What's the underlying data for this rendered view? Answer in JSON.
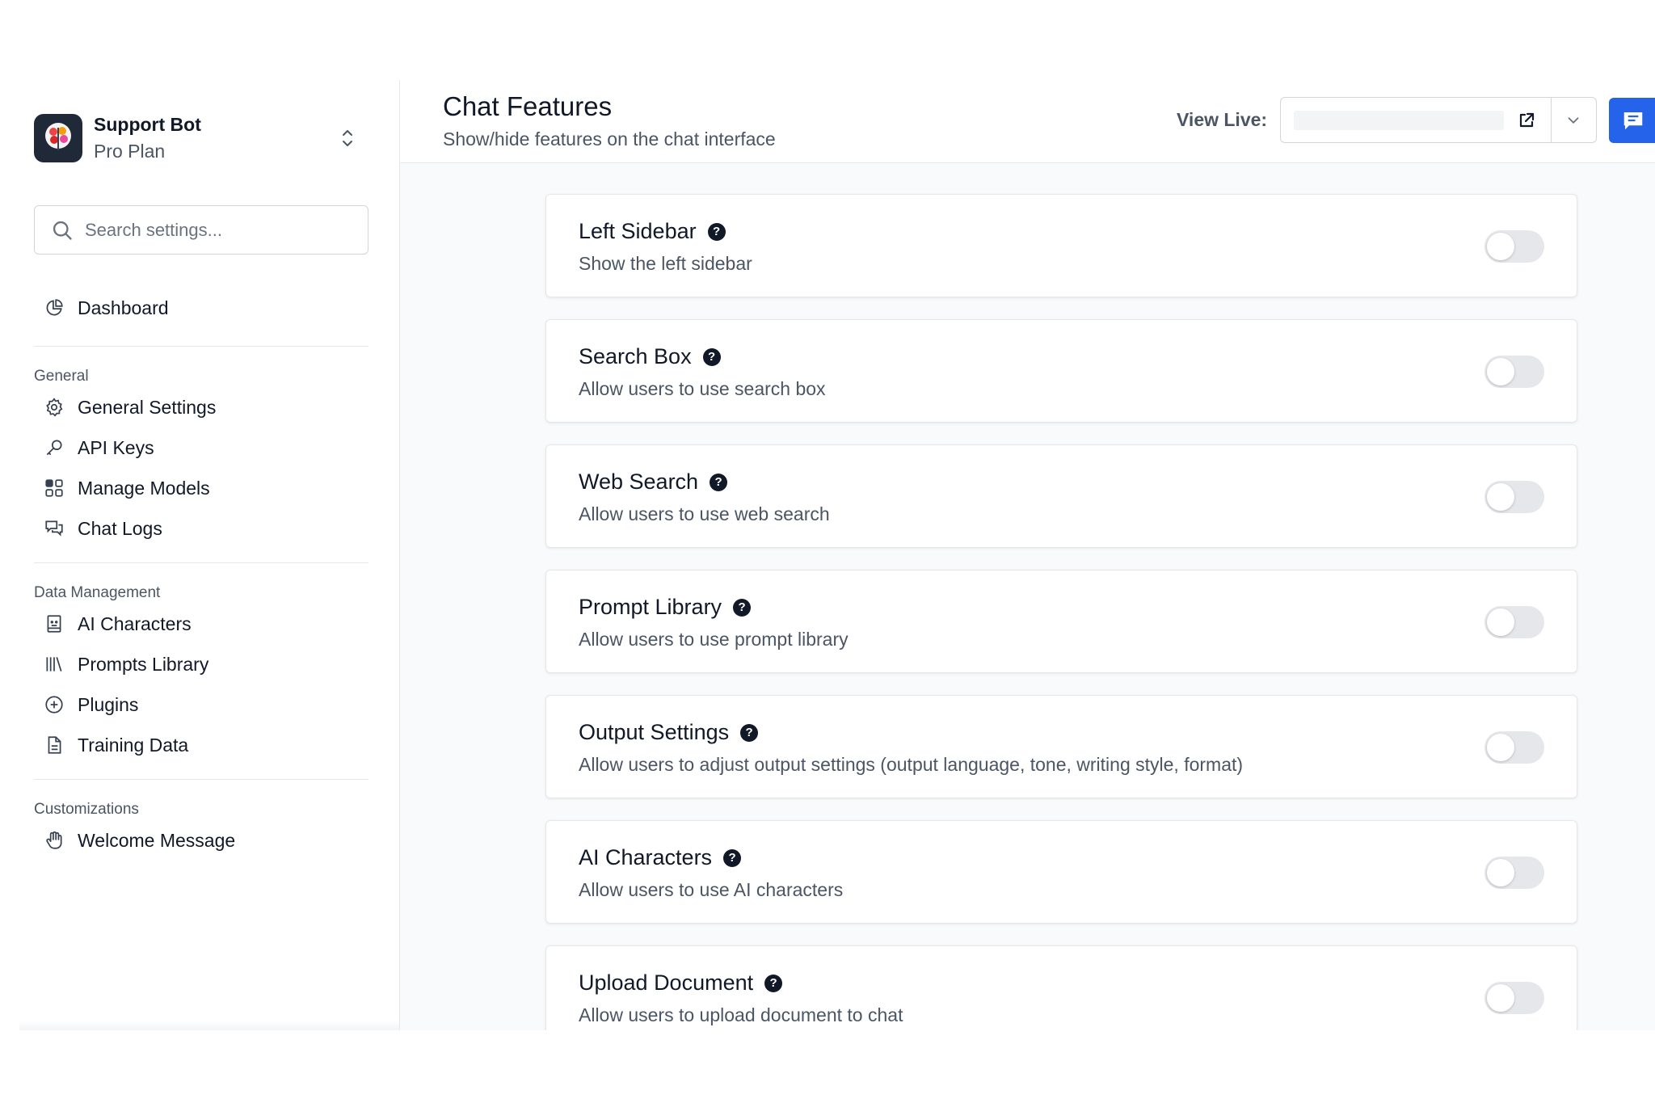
{
  "brand": {
    "name": "Support Bot",
    "plan": "Pro Plan"
  },
  "search": {
    "placeholder": "Search settings..."
  },
  "nav": {
    "dashboard": "Dashboard",
    "sections": [
      {
        "label": "General",
        "items": [
          "General Settings",
          "API Keys",
          "Manage Models",
          "Chat Logs"
        ]
      },
      {
        "label": "Data Management",
        "items": [
          "AI Characters",
          "Prompts Library",
          "Plugins",
          "Training Data"
        ]
      },
      {
        "label": "Customizations",
        "items": [
          "Welcome Message"
        ]
      }
    ]
  },
  "header": {
    "title": "Chat Features",
    "subtitle": "Show/hide features on the chat interface",
    "view_live_label": "View Live:"
  },
  "features": [
    {
      "title": "Left Sidebar",
      "description": "Show the left sidebar",
      "enabled": false
    },
    {
      "title": "Search Box",
      "description": "Allow users to use search box",
      "enabled": false
    },
    {
      "title": "Web Search",
      "description": "Allow users to use web search",
      "enabled": false
    },
    {
      "title": "Prompt Library",
      "description": "Allow users to use prompt library",
      "enabled": false
    },
    {
      "title": "Output Settings",
      "description": "Allow users to adjust output settings (output language, tone, writing style, format)",
      "enabled": false
    },
    {
      "title": "AI Characters",
      "description": "Allow users to use AI characters",
      "enabled": false
    },
    {
      "title": "Upload Document",
      "description": "Allow users to upload document to chat",
      "enabled": false
    }
  ],
  "colors": {
    "primary": "#2563eb",
    "toggle_off": "#e5e7eb"
  }
}
